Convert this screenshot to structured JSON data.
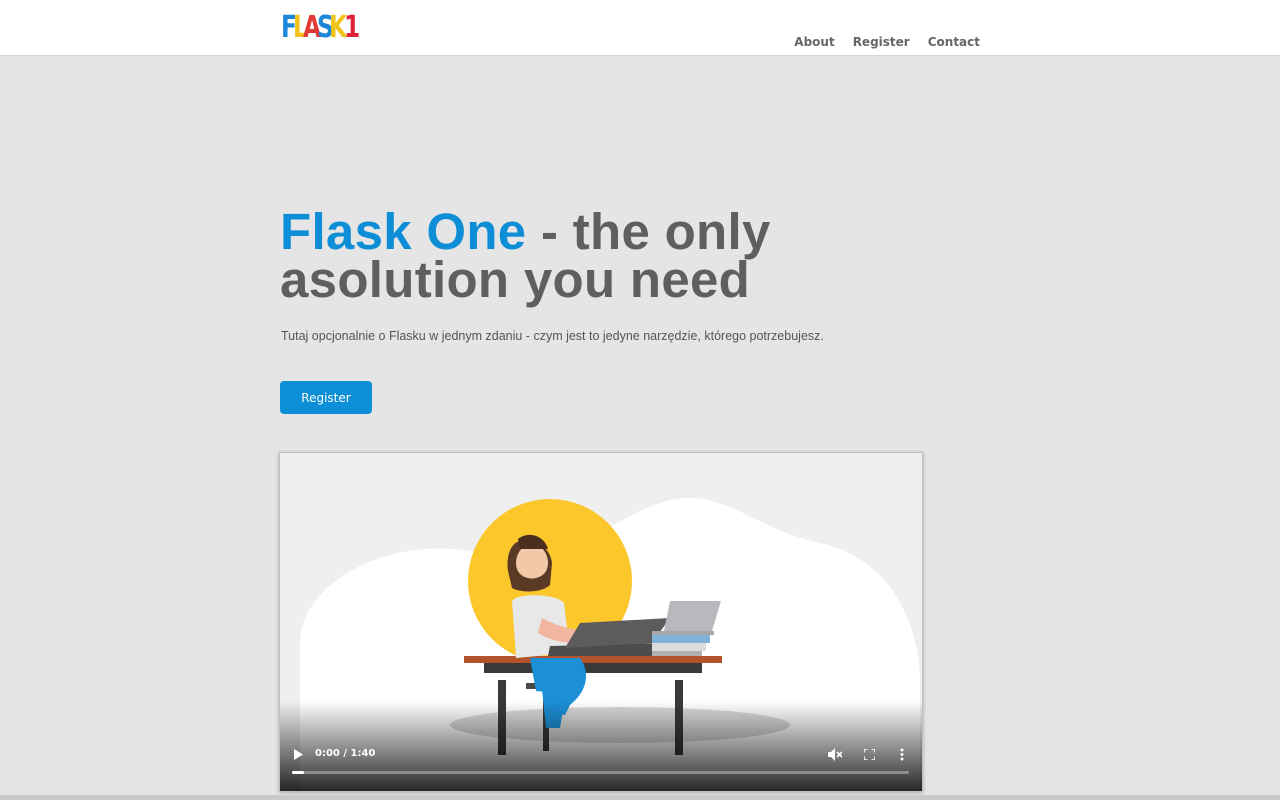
{
  "header": {
    "logo": {
      "letters": [
        {
          "char": "F",
          "color": "#1e88d8"
        },
        {
          "char": "L",
          "color": "#f2c318"
        },
        {
          "char": "A",
          "color": "#e23a34"
        },
        {
          "char": "S",
          "color": "#1e88d8"
        },
        {
          "char": "K",
          "color": "#f2c318"
        },
        {
          "char": "1",
          "color": "#e0233a"
        }
      ]
    },
    "nav": [
      "About",
      "Register",
      "Contact"
    ]
  },
  "hero": {
    "title_brand": "Flask One",
    "title_rest": " - the only asolution you need",
    "subtitle": "Tutaj opcjonalnie o Flasku w jednym zdaniu - czym jest to jedyne narzędzie, którego potrzebujesz.",
    "cta_label": "Register"
  },
  "video": {
    "time": "0:00 / 1:40",
    "progress": 0,
    "icons": [
      "play-icon",
      "mute-icon",
      "fullscreen-icon",
      "more-options-icon"
    ]
  },
  "colors": {
    "accent": "#0d8fd8",
    "text": "#5f5f5f",
    "background": "#e5e5e5"
  }
}
